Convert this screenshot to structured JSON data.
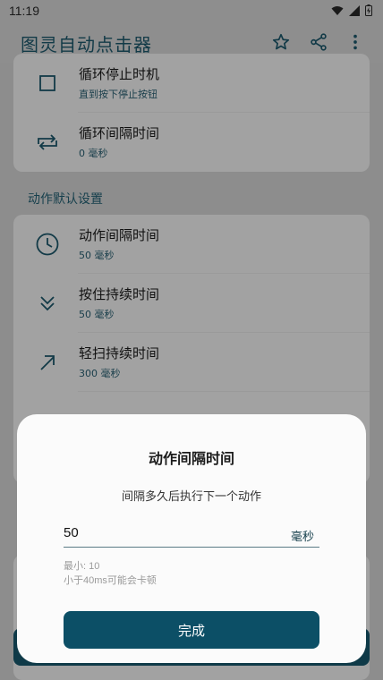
{
  "status": {
    "time": "11:19"
  },
  "app": {
    "title": "图灵自动点击器"
  },
  "icons": {
    "star": "star-icon",
    "share": "share-icon",
    "more": "more-vert-icon"
  },
  "settings_top": [
    {
      "icon": "checkbox-icon",
      "title": "循环停止时机",
      "subtitle": "直到按下停止按钮"
    },
    {
      "icon": "repeat-icon",
      "title": "循环间隔时间",
      "subtitle": "0 毫秒"
    }
  ],
  "section_label": "动作默认设置",
  "settings_actions": [
    {
      "icon": "clock-icon",
      "title": "动作间隔时间",
      "subtitle": "50 毫秒"
    },
    {
      "icon": "chevrons-down-icon",
      "title": "按住持续时间",
      "subtitle": "50 毫秒"
    },
    {
      "icon": "arrow-up-right-icon",
      "title": "轻扫持续时间",
      "subtitle": "300 毫秒"
    }
  ],
  "dialog": {
    "title": "动作间隔时间",
    "subtitle": "间隔多久后执行下一个动作",
    "value": "50",
    "unit": "毫秒",
    "hint_min": "最小: 10",
    "hint_warn": "小于40ms可能会卡顿",
    "confirm_label": "完成"
  },
  "colors": {
    "accent": "#0c4f66",
    "overlay_bg": "#8d8d8d"
  }
}
